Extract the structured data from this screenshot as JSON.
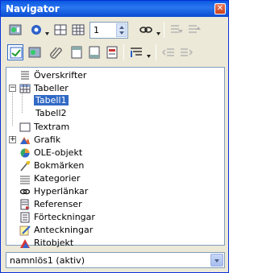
{
  "window": {
    "title": "Navigator",
    "close": "✕"
  },
  "toolbar": {
    "spin_value": "1"
  },
  "tree": {
    "items": [
      {
        "label": "Överskrifter",
        "icon": "headings-icon"
      },
      {
        "label": "Tabeller",
        "icon": "tables-icon",
        "expanded": true,
        "children": [
          {
            "label": "Tabell1",
            "selected": true
          },
          {
            "label": "Tabell2"
          }
        ]
      },
      {
        "label": "Textram",
        "icon": "text-frame-icon"
      },
      {
        "label": "Grafik",
        "icon": "graphics-icon",
        "collapsed": true
      },
      {
        "label": "OLE-objekt",
        "icon": "ole-object-icon"
      },
      {
        "label": "Bokmärken",
        "icon": "bookmarks-icon"
      },
      {
        "label": "Kategorier",
        "icon": "categories-icon"
      },
      {
        "label": "Hyperlänkar",
        "icon": "hyperlinks-icon"
      },
      {
        "label": "Referenser",
        "icon": "references-icon"
      },
      {
        "label": "Förteckningar",
        "icon": "indexes-icon"
      },
      {
        "label": "Anteckningar",
        "icon": "comments-icon"
      },
      {
        "label": "Ritobjekt",
        "icon": "drawing-objects-icon"
      }
    ]
  },
  "document_select": {
    "value": "namnlös1 (aktiv)"
  },
  "colors": {
    "titlebar": "#0a58e0",
    "selection": "#316ac5",
    "frame": "#ece9d8"
  }
}
